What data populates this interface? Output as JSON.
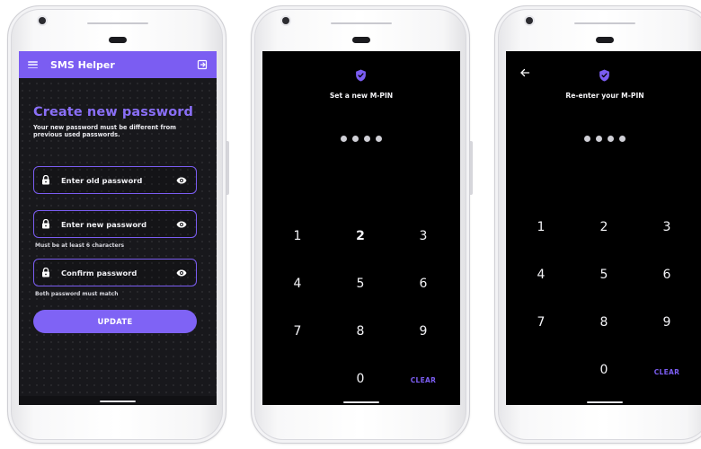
{
  "colors": {
    "accent": "#7b5df2",
    "background_dark": "#18181c",
    "pin_background": "#000000",
    "text": "#f2f2f5"
  },
  "screen1": {
    "app_title": "SMS Helper",
    "heading": "Create new password",
    "description": "Your new password must be different from previous used passwords.",
    "fields": [
      {
        "placeholder": "Enter old password",
        "hint": ""
      },
      {
        "placeholder": "Enter new password",
        "hint": "Must be at least 6 characters"
      },
      {
        "placeholder": "Confirm password",
        "hint": "Both password must match"
      }
    ],
    "update_label": "UPDATE"
  },
  "screen2": {
    "title": "Set a new M-PIN",
    "pin_length": 4,
    "keys": [
      "1",
      "2",
      "3",
      "4",
      "5",
      "6",
      "7",
      "8",
      "9",
      "0"
    ],
    "clear_label": "CLEAR"
  },
  "screen3": {
    "title": "Re-enter your M-PIN",
    "pin_length": 4,
    "keys": [
      "1",
      "2",
      "3",
      "4",
      "5",
      "6",
      "7",
      "8",
      "9",
      "0"
    ],
    "clear_label": "CLEAR"
  }
}
